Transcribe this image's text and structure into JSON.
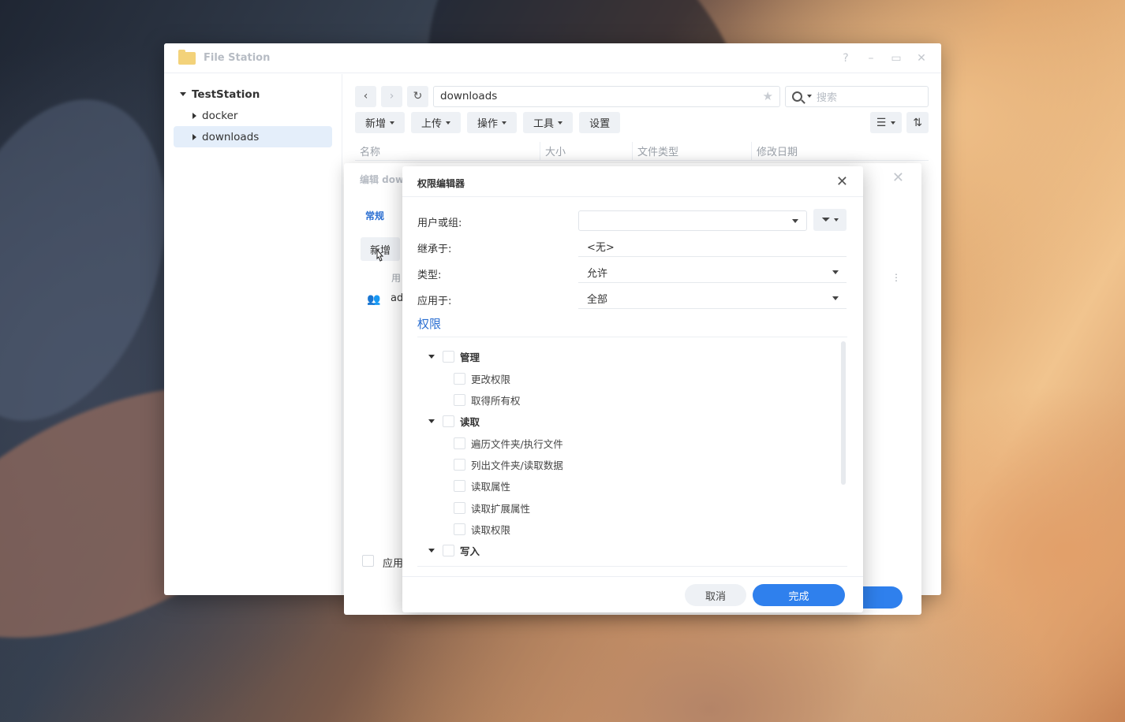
{
  "window": {
    "title": "File Station",
    "controls": [
      "?",
      "–",
      "▭",
      "✕"
    ]
  },
  "sidebar": {
    "root": "TestStation",
    "items": [
      {
        "label": "docker"
      },
      {
        "label": "downloads",
        "selected": true
      }
    ]
  },
  "navbar": {
    "back_icon": "‹",
    "forward_icon": "›",
    "refresh_icon": "↻",
    "path": "downloads",
    "star_icon": "★",
    "search_placeholder": "搜索"
  },
  "toolbar": {
    "buttons": [
      "新增",
      "上传",
      "操作",
      "工具",
      "设置"
    ],
    "list_view_icon": "☰",
    "sort_icon": "⇅"
  },
  "file_list": {
    "columns": [
      "名称",
      "大小",
      "文件类型",
      "修改日期"
    ]
  },
  "edit_dialog": {
    "title": "编辑 dow",
    "tab_general": "常规",
    "add_button": "新增",
    "col_user": "用",
    "row_user": "ad",
    "apply_label": "应用"
  },
  "perm_editor": {
    "title": "权限编辑器",
    "user_or_group_label": "用户或组:",
    "user_or_group_value": "",
    "inherit_label": "继承于:",
    "inherit_value": "<无>",
    "type_label": "类型:",
    "type_value": "允许",
    "apply_to_label": "应用于:",
    "apply_to_value": "全部",
    "section_title": "权限",
    "groups": [
      {
        "label": "管理",
        "children": [
          "更改权限",
          "取得所有权"
        ]
      },
      {
        "label": "读取",
        "children": [
          "遍历文件夹/执行文件",
          "列出文件夹/读取数据",
          "读取属性",
          "读取扩展属性",
          "读取权限"
        ]
      },
      {
        "label": "写入",
        "children": []
      }
    ],
    "cancel_button": "取消",
    "done_button": "完成"
  },
  "colors": {
    "accent": "#2f80ed",
    "link": "#2a6ed1",
    "selected_bg": "#e4eefa"
  }
}
